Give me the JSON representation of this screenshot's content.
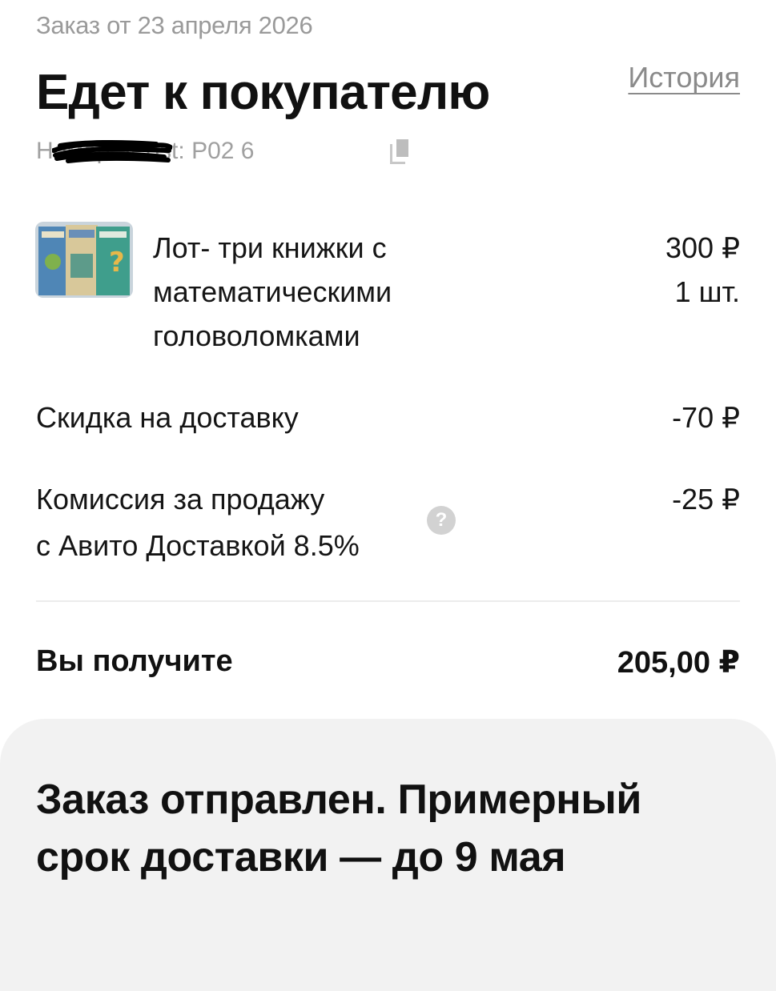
{
  "header": {
    "order_date": "Заказ от 23 апреля 2026",
    "status_title": "Едет к покупателю",
    "history_link": "История",
    "tracking_prefix": "Номер 5Post: P02 6"
  },
  "item": {
    "title": "Лот- три книжки с математическими головоломками",
    "price": "300 ₽",
    "quantity": "1 шт."
  },
  "rows": [
    {
      "label": "Скидка на доставку",
      "value": "-70 ₽"
    },
    {
      "label_line1": "Комиссия за продажу",
      "label_line2": "с Авито Доставкой 8.5%",
      "value": "-25 ₽"
    }
  ],
  "total": {
    "label": "Вы получите",
    "value": "205,00 ₽"
  },
  "shipping": {
    "message": "Заказ отправлен. Примерный срок доставки — до 9 мая"
  },
  "icons": {
    "help": "question-circle-icon",
    "copy": "copy-icon"
  },
  "colors": {
    "muted_text": "#9a9a9a",
    "card_background": "#f2f2f2"
  }
}
